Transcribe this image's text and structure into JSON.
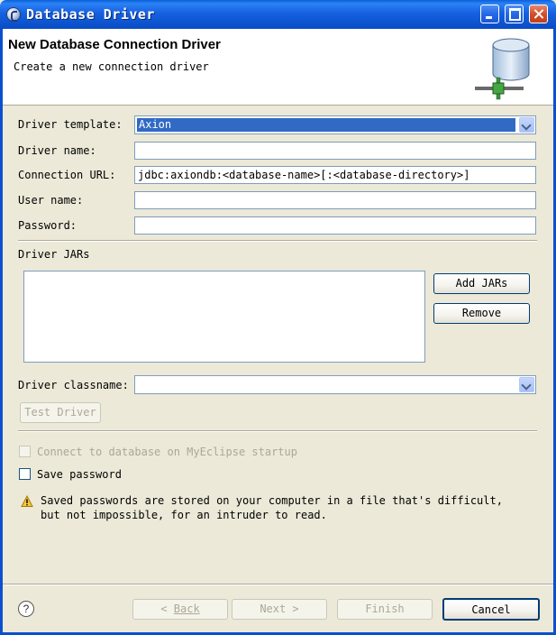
{
  "window": {
    "title": "Database Driver"
  },
  "header": {
    "title": "New Database Connection Driver",
    "subtitle": "Create a new connection driver"
  },
  "form": {
    "template_label": "Driver template:",
    "template_value": "Axion",
    "name_label": "Driver name:",
    "name_value": "",
    "url_label": "Connection URL:",
    "url_value": "jdbc:axiondb:<database-name>[:<database-directory>]",
    "user_label": "User name:",
    "user_value": "",
    "password_label": "Password:",
    "password_value": ""
  },
  "jars": {
    "section_label": "Driver JARs",
    "items": [],
    "add_label": "Add JARs",
    "remove_label": "Remove"
  },
  "classname": {
    "label": "Driver classname:",
    "value": ""
  },
  "test_driver_label": "Test Driver",
  "options": {
    "connect_on_startup_label": "Connect to database on MyEclipse startup",
    "connect_on_startup_checked": false,
    "connect_on_startup_enabled": false,
    "save_password_label": "Save password",
    "save_password_checked": false
  },
  "warning": {
    "line1": "Saved passwords are stored on your computer in a file that's difficult,",
    "line2": "but not impossible, for an intruder to read."
  },
  "footer": {
    "back_label": "Back",
    "next_label": "Next >",
    "finish_label": "Finish",
    "cancel_label": "Cancel"
  },
  "icons": {
    "app": "eclipse-icon",
    "header": "database-connection-icon",
    "warning": "warning-icon",
    "help": "help-icon"
  }
}
